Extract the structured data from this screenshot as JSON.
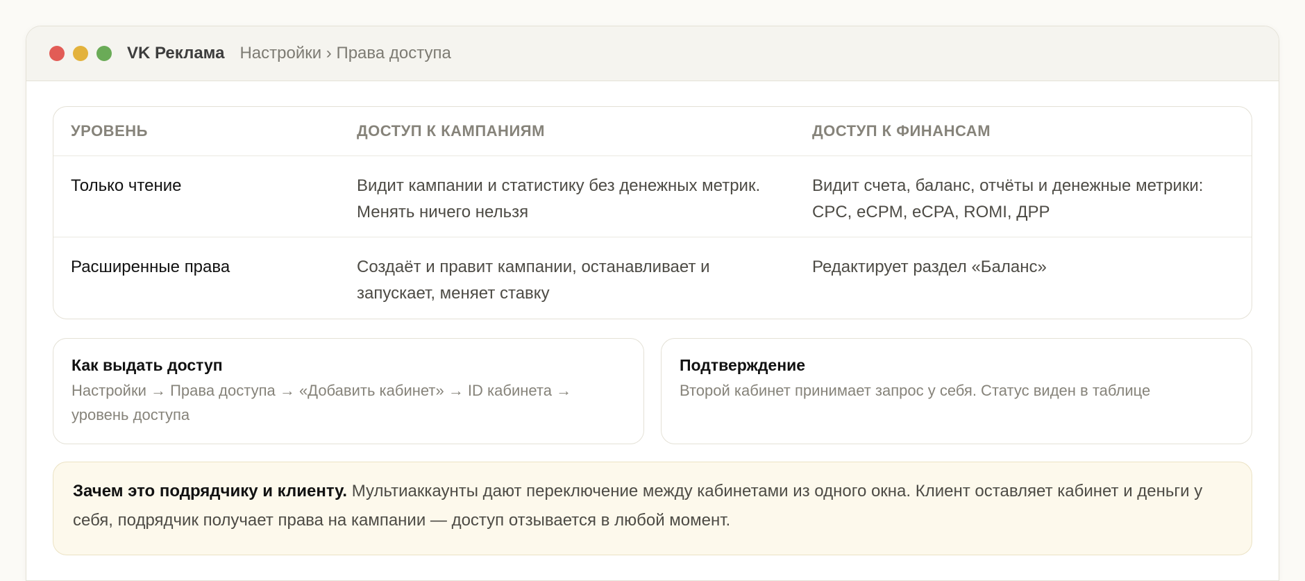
{
  "window": {
    "app_title": "VK Реклама",
    "breadcrumb": "Настройки › Права доступа"
  },
  "table": {
    "headers": [
      "УРОВЕНЬ",
      "ДОСТУП К КАМПАНИЯМ",
      "ДОСТУП К ФИНАНСАМ"
    ],
    "rows": [
      {
        "level": "Только чтение",
        "campaigns": "Видит кампании и статистику без денежных метрик. Менять ничего нельзя",
        "finance": "Видит счета, баланс, отчёты и денежные метрики: CPC, eCPM, eCPA, ROMI, ДРР"
      },
      {
        "level": "Расширенные права",
        "campaigns": "Создаёт и правит кампании, останавливает и запускает, меняет ставку",
        "finance": "Редактирует раздел «Баланс»"
      }
    ]
  },
  "cards": [
    {
      "title": "Как выдать доступ",
      "text": "Настройки → Права доступа → «Добавить кабинет» → ID кабинета → уровень доступа"
    },
    {
      "title": "Подтверждение",
      "text": "Второй кабинет принимает запрос у себя. Статус виден в таблице"
    }
  ],
  "note": {
    "strong": "Зачем это подрядчику и клиенту.",
    "text": "Мультиаккаунты дают переключение между кабинетами из одного окна. Клиент оставляет кабинет и деньги у себя, подрядчик получает права на кампании — доступ отзывается в любой момент."
  },
  "colors": {
    "close": "#e25c56",
    "minimize": "#e3b23c",
    "maximize": "#6aab57",
    "note_background": "#fdf9ec"
  }
}
